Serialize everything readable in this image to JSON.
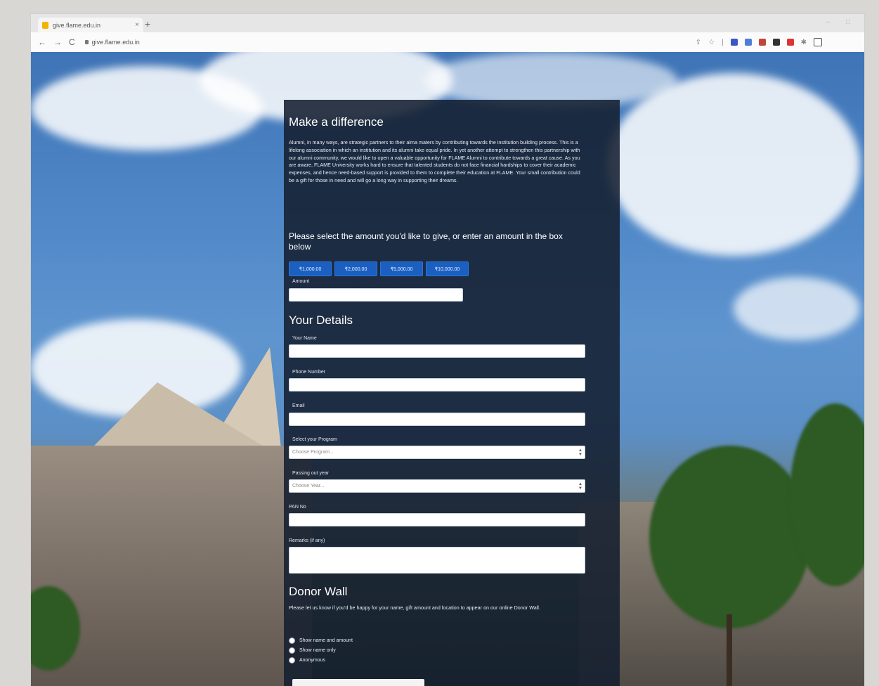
{
  "browser": {
    "tab_title": "give.flame.edu.in",
    "tab_close": "×",
    "new_tab": "+",
    "url": "give.flame.edu.in",
    "nav_back": "←",
    "nav_forward": "→",
    "nav_reload": "C"
  },
  "page": {
    "title": "Make a difference",
    "intro": "Alumni, in many ways, are strategic partners to their alma maters by contributing towards the institution building process. This is a lifelong association in which an institution and its alumni take equal pride. In yet another attempt to strengthen this partnership with our alumni community, we would like to open a valuable opportunity for FLAME Alumni to contribute towards a great cause. As you are aware, FLAME University works hard to ensure that talented students do not face financial hardships to cover their academic expenses, and hence need-based support is provided to them to complete their education at FLAME. Your small contribution could be a gift for those in need and will go a long way in supporting their dreams.",
    "amount_heading": "Please select the amount you'd like to give, or enter an amount in the box below",
    "amount_buttons": [
      "₹1,000.00",
      "₹2,000.00",
      "₹5,000.00",
      "₹10,000.00"
    ],
    "amount_label": "Amount",
    "details_heading": "Your Details",
    "fields": {
      "name": "Your Name",
      "phone": "Phone Number",
      "email": "Email",
      "program": "Select your Program",
      "program_placeholder": "Choose Program...",
      "year": "Passing out year",
      "year_placeholder": "Choose Year...",
      "pan": "PAN No",
      "remarks": "Remarks (if any)"
    },
    "donor_heading": "Donor Wall",
    "donor_text": "Please let us know if you'd be happy for your name, gift amount and location to appear on our online Donor Wall.",
    "donor_options": [
      "Show name and amount",
      "Show name only",
      "Anonymous"
    ]
  }
}
